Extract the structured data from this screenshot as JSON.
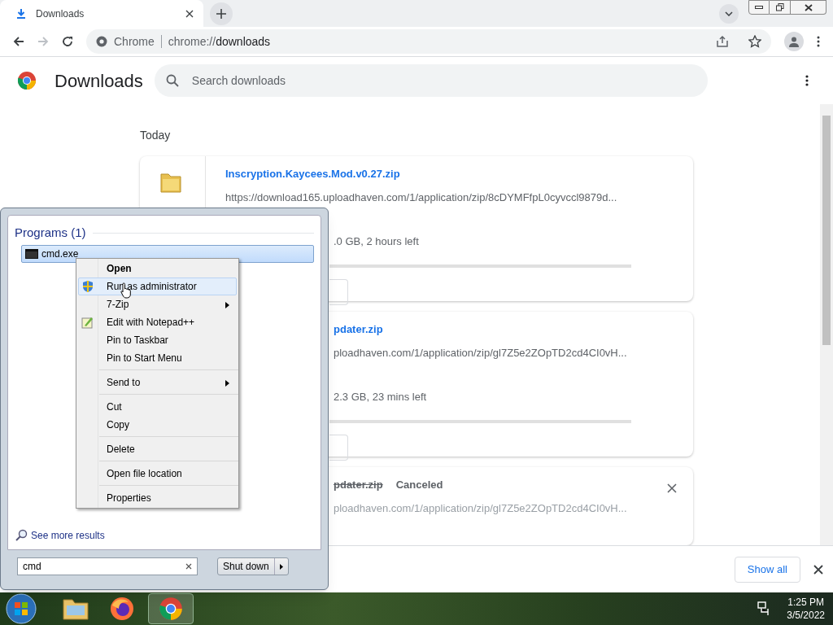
{
  "tab": {
    "title": "Downloads"
  },
  "address_bar": {
    "site_label": "Chrome",
    "url_prefix": "chrome://",
    "url_path": "downloads"
  },
  "page": {
    "title": "Downloads",
    "search": {
      "placeholder": "Search downloads"
    }
  },
  "section_heading": "Today",
  "downloads": [
    {
      "kind": "progress",
      "partly_hidden": false,
      "name": "Inscryption.Kaycees.Mod.v0.27.zip",
      "url": "https://download165.uploadhaven.com/1/application/zip/8cDYMFfpL0cyvccl9879d...",
      "status": ".0 GB, 2 hours left"
    },
    {
      "kind": "progress",
      "partly_hidden": true,
      "name": "pdater.zip",
      "url": "ploadhaven.com/1/application/zip/gl7Z5e2ZOpTD2cd4CI0vH...",
      "status": "2.3 GB, 23 mins left"
    },
    {
      "kind": "canceled",
      "partly_hidden": true,
      "name": "pdater.zip",
      "state": "Canceled",
      "url": "ploadhaven.com/1/application/zip/gl7Z5e2ZOpTD2cd4CI0vH..."
    }
  ],
  "shelf": {
    "show_all": "Show all"
  },
  "start_menu": {
    "group_heading": "Programs (1)",
    "results": [
      {
        "label": "cmd.exe",
        "selected": true
      }
    ],
    "see_more": "See more results",
    "search_value": "cmd",
    "shutdown": "Shut down"
  },
  "context_menu": {
    "groups": [
      [
        {
          "label": "Open",
          "kind": "plain",
          "default": true,
          "selected": false,
          "submenu": false
        },
        {
          "label": "Run as administrator",
          "kind": "elevated",
          "default": false,
          "selected": true,
          "submenu": false
        },
        {
          "label": "7-Zip",
          "kind": "plain",
          "default": false,
          "selected": false,
          "submenu": true
        },
        {
          "label": "Edit with Notepad++",
          "kind": "editor",
          "default": false,
          "selected": false,
          "submenu": false
        },
        {
          "label": "Pin to Taskbar",
          "kind": "plain",
          "default": false,
          "selected": false,
          "submenu": false
        },
        {
          "label": "Pin to Start Menu",
          "kind": "plain",
          "default": false,
          "selected": false,
          "submenu": false
        }
      ],
      [
        {
          "label": "Send to",
          "kind": "plain",
          "default": false,
          "selected": false,
          "submenu": true
        }
      ],
      [
        {
          "label": "Cut",
          "kind": "plain",
          "default": false,
          "selected": false,
          "submenu": false
        },
        {
          "label": "Copy",
          "kind": "plain",
          "default": false,
          "selected": false,
          "submenu": false
        }
      ],
      [
        {
          "label": "Delete",
          "kind": "plain",
          "default": false,
          "selected": false,
          "submenu": false
        }
      ],
      [
        {
          "label": "Open file location",
          "kind": "plain",
          "default": false,
          "selected": false,
          "submenu": false
        }
      ],
      [
        {
          "label": "Properties",
          "kind": "plain",
          "default": false,
          "selected": false,
          "submenu": false
        }
      ]
    ]
  },
  "taskbar": {
    "time": "1:25 PM",
    "date": "3/5/2022"
  }
}
